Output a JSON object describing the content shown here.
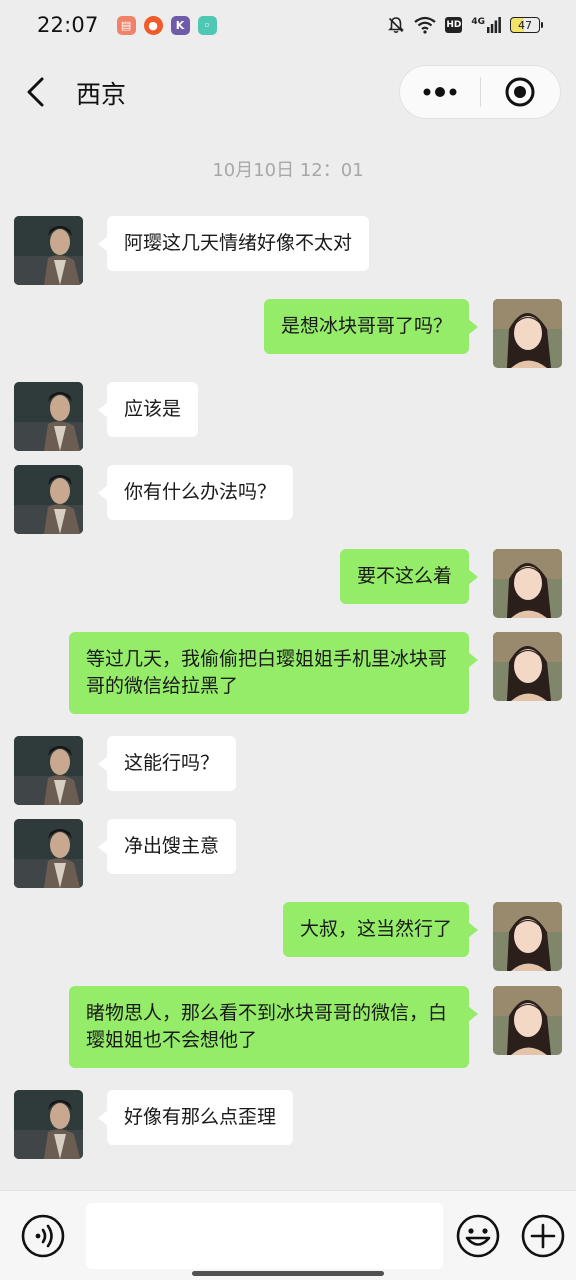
{
  "status_bar": {
    "time": "22:07",
    "hd_label": "HD",
    "network_label": "4G",
    "battery_level": "47",
    "app_icons": [
      "reader-app-icon",
      "tomato-app-icon",
      "k-app-icon",
      "chat-app-icon"
    ]
  },
  "nav": {
    "title": "西京"
  },
  "chat": {
    "timestamp": "10月10日 12：01",
    "messages": [
      {
        "side": "left",
        "text": "阿璎这几天情绪好像不太对"
      },
      {
        "side": "right",
        "text": "是想冰块哥哥了吗？"
      },
      {
        "side": "left",
        "text": "应该是"
      },
      {
        "side": "left",
        "text": "你有什么办法吗？"
      },
      {
        "side": "right",
        "text": "要不这么着"
      },
      {
        "side": "right",
        "text": "等过几天，我偷偷把白璎姐姐手机里冰块哥哥的微信给拉黑了"
      },
      {
        "side": "left",
        "text": "这能行吗？"
      },
      {
        "side": "left",
        "text": "净出馊主意"
      },
      {
        "side": "right",
        "text": "大叔，这当然行了"
      },
      {
        "side": "right",
        "text": "睹物思人，那么看不到冰块哥哥的微信，白璎姐姐也不会想他了"
      },
      {
        "side": "left",
        "text": "好像有那么点歪理"
      }
    ]
  },
  "input_bar": {
    "value": ""
  },
  "colors": {
    "background": "#ededed",
    "bubble_left": "#ffffff",
    "bubble_right": "#95ec69",
    "timestamp": "#a8a8a8"
  }
}
